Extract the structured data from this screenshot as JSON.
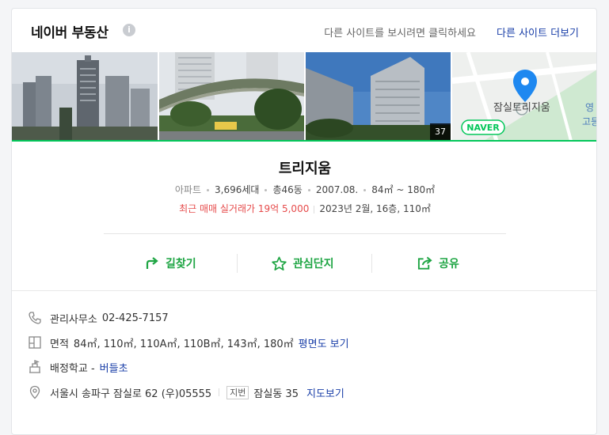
{
  "header": {
    "title": "네이버 부동산",
    "info_glyph": "i",
    "hint": "다른 사이트를 보시려면 클릭하세요",
    "link": "다른 사이트 더보기"
  },
  "photos": {
    "count": "37",
    "map_label": "잠실트리지움",
    "map_side_label_1": "영",
    "map_side_label_2": "고등",
    "naver_badge": "NAVER"
  },
  "complex": {
    "name": "트리지움",
    "type": "아파트",
    "households": "3,696세대",
    "buildings": "총46동",
    "built": "2007.08.",
    "area_range": "84㎡ ~ 180㎡",
    "recent_deal_label": "최근 매매 실거래가 19억 5,000",
    "recent_deal_detail": "2023년 2월, 16층, 110㎡"
  },
  "actions": {
    "directions": "길찾기",
    "favorite": "관심단지",
    "share": "공유"
  },
  "details": {
    "office_label": "관리사무소",
    "office_phone": "02-425-7157",
    "area_label": "면적",
    "area_values": "84㎡, 110㎡, 110A㎡, 110B㎡, 143㎡, 180㎡",
    "floorplan_link": "평면도 보기",
    "school_label": "배정학교 -",
    "school_name": "버들초",
    "address": "서울시 송파구 잠실로 62 (우)05555",
    "lot_chip": "지번",
    "lot_address": "잠실동 35",
    "map_link": "지도보기"
  },
  "colors": {
    "accent_green": "#03c75a",
    "action_green": "#1ea543",
    "link_blue": "#1a3fa8",
    "deal_red": "#e64b4b"
  }
}
